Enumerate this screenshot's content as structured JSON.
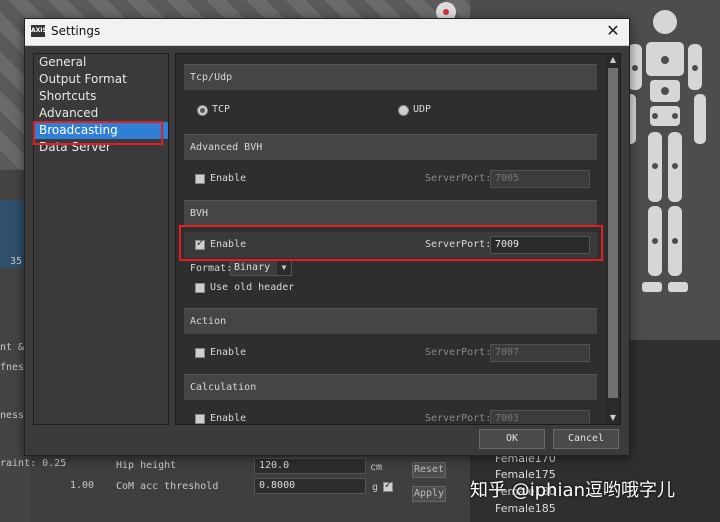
{
  "background": {
    "left_labels": [
      "35",
      "nt &",
      "fnes",
      "ness",
      "raint: 0.25",
      "1.00"
    ],
    "hip_height_label": "Hip height",
    "hip_height_value": "120.0",
    "hip_height_unit": "cm",
    "com_label": "CoM acc threshold",
    "com_value": "0.8000",
    "com_unit": "g",
    "reset_label": "Reset",
    "apply_label": "Apply",
    "list_items": [
      "Female170",
      "Female175",
      "Female180",
      "Female185"
    ],
    "watermark": "知乎 @iphian逗哟哦字儿"
  },
  "dialog": {
    "title": "Settings",
    "app_icon_text": "AXIS",
    "close_symbol": "✕",
    "nav_items": [
      "General",
      "Output Format",
      "Shortcuts",
      "Advanced",
      "Broadcasting",
      "Data Server"
    ],
    "selected_nav": "Broadcasting",
    "sections": {
      "tcpudp": {
        "title": "Tcp/Udp",
        "tcp": "TCP",
        "udp": "UDP",
        "selected": "TCP"
      },
      "advanced_bvh": {
        "title": "Advanced BVH",
        "enable": "Enable",
        "port_label": "ServerPort:",
        "port": "7005",
        "enabled": false
      },
      "bvh": {
        "title": "BVH",
        "enable": "Enable",
        "port_label": "ServerPort:",
        "port": "7009",
        "enabled": true,
        "format_label": "Format:",
        "format": "Binary",
        "old_header": "Use old header"
      },
      "action": {
        "title": "Action",
        "enable": "Enable",
        "port_label": "ServerPort:",
        "port": "7007",
        "enabled": false
      },
      "calculation": {
        "title": "Calculation",
        "enable": "Enable",
        "port_label": "ServerPort:",
        "port": "7003",
        "enabled": false
      }
    },
    "ok_label": "OK",
    "cancel_label": "Cancel"
  },
  "colors": {
    "highlight": "#e02020",
    "selection": "#2f7fd6"
  }
}
